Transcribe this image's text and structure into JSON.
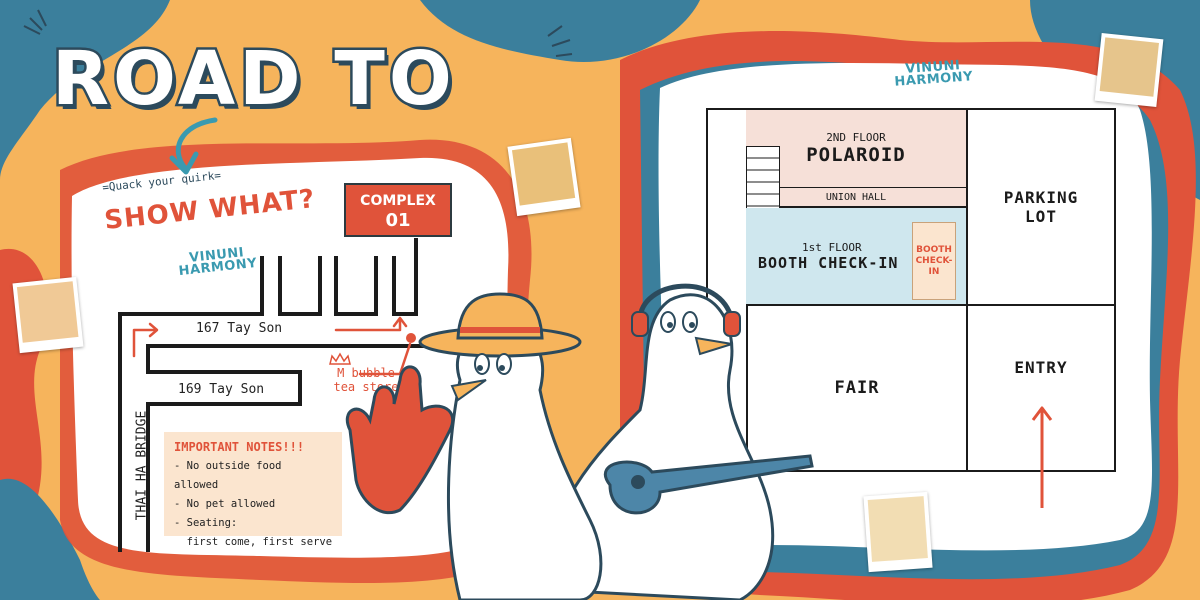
{
  "left": {
    "title": "ROAD TO",
    "tagline": "=Quack your quirk=",
    "show_what": "SHOW WHAT?",
    "brand_line1": "VINUNI",
    "brand_line2": "HARMONY",
    "complex_line1": "COMPLEX",
    "complex_line2": "01",
    "streets": {
      "tay_son_167": "167 Tay Son",
      "tay_son_169": "169 Tay Son",
      "bridge": "THAI HA BRIDGE"
    },
    "landmark_line1": "M bubble",
    "landmark_line2": "tea store",
    "notes": {
      "heading": "IMPORTANT NOTES!!!",
      "items": [
        "- No outside food allowed",
        "- No pet allowed",
        "- Seating:",
        "  first come, first serve"
      ]
    }
  },
  "right": {
    "brand_line1": "VINUNI",
    "brand_line2": "HARMONY",
    "rooms": {
      "polaroid_floor": "2ND FLOOR",
      "polaroid_name": "POLAROID",
      "union_hall": "UNION HALL",
      "booth_floor": "1st FLOOR",
      "booth_name": "BOOTH CHECK-IN",
      "parking_line1": "PARKING",
      "parking_line2": "LOT",
      "fair": "FAIR",
      "entry": "ENTRY"
    },
    "poster_line1": "BOOTH",
    "poster_line2": "CHECK-IN"
  },
  "colors": {
    "orange_bg": "#f6b45c",
    "red": "#e0533a",
    "blue": "#3b7f9c",
    "teal_text": "#3a9ab0",
    "pink_room": "#f6e0d8",
    "blue_room": "#cfe7ee",
    "dark": "#2c4a5c"
  }
}
